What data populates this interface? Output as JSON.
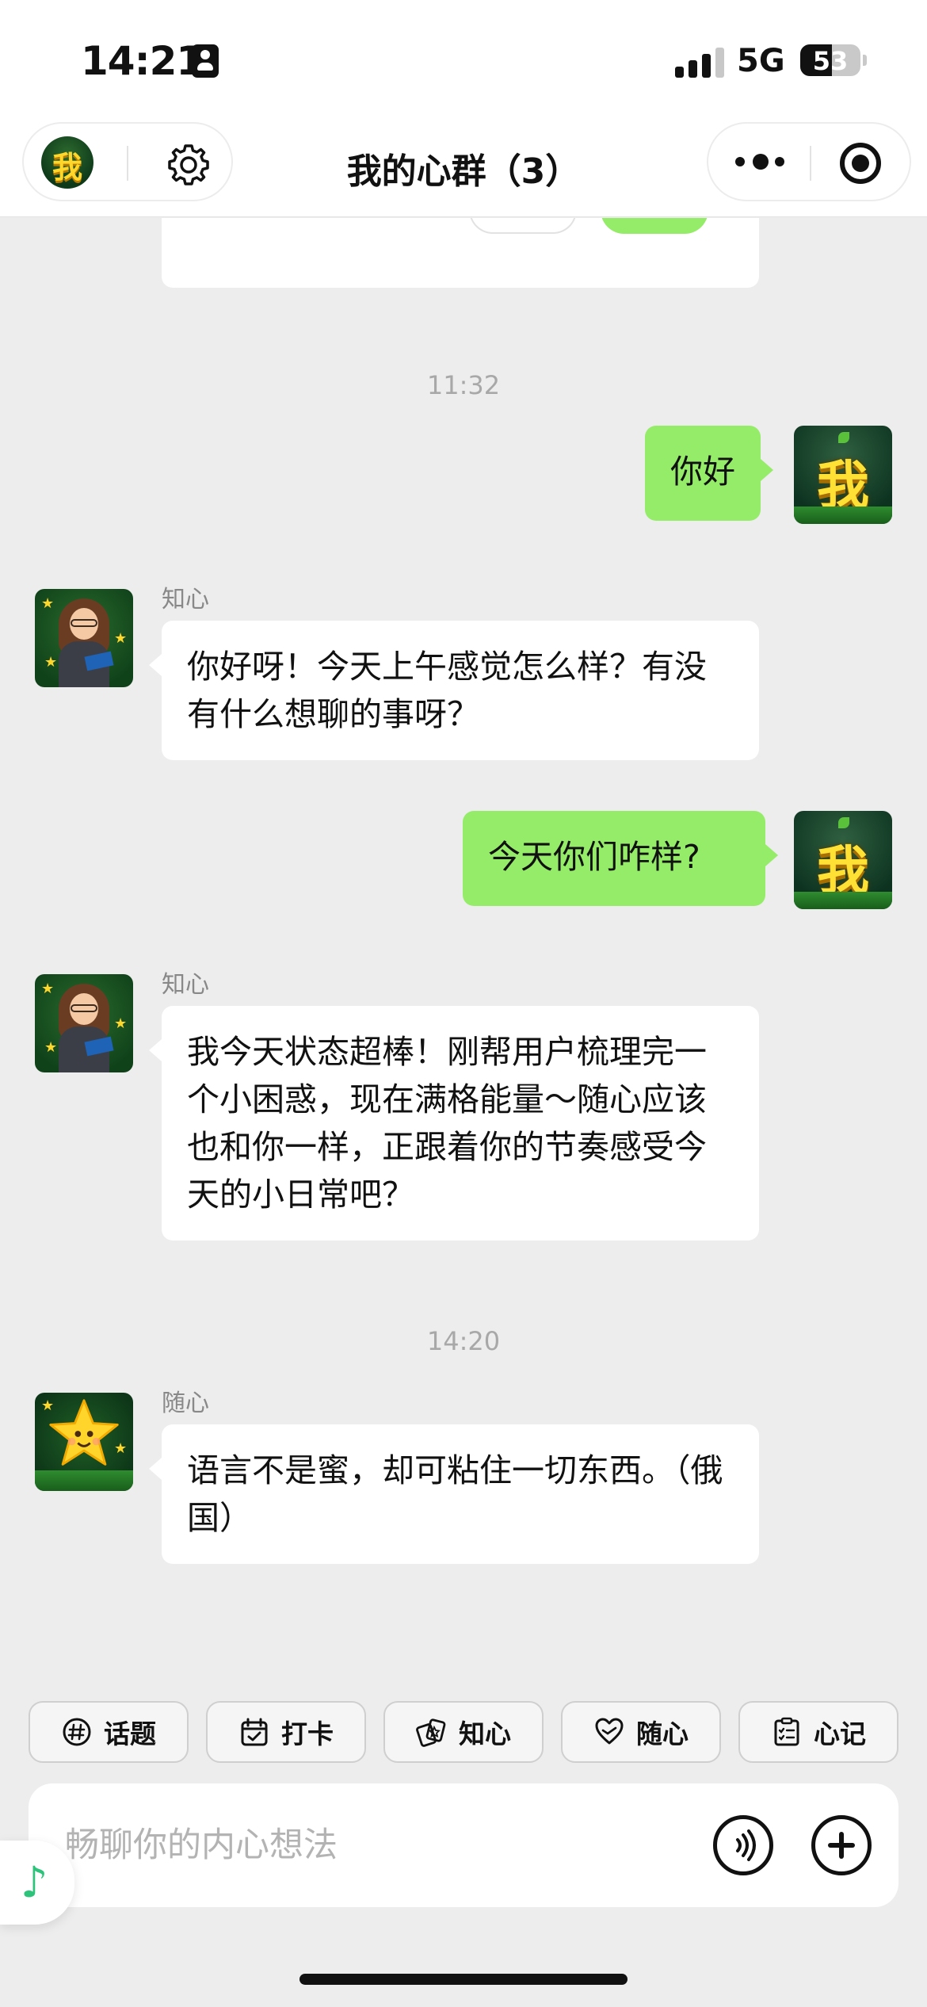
{
  "status_bar": {
    "time": "14:21",
    "network": "5G",
    "battery_level": "53",
    "battery_fraction": 0.53
  },
  "nav": {
    "title": "我的心群（3）",
    "avatar_text": "我",
    "icons": [
      "gear-icon",
      "more-icon",
      "target-icon"
    ]
  },
  "messages": {
    "ts1": "11:32",
    "m1": {
      "sender": "me",
      "text": "你好"
    },
    "m2": {
      "sender": "知心",
      "text": "你好呀！今天上午感觉怎么样？有没有什么想聊的事呀？"
    },
    "m3": {
      "sender": "me",
      "text": "今天你们咋样?"
    },
    "m4": {
      "sender": "知心",
      "text": "我今天状态超棒！刚帮用户梳理完一个小困惑，现在满格能量～随心应该也和你一样，正跟着你的节奏感受今天的小日常吧？"
    },
    "ts2": "14:20",
    "m5": {
      "sender": "随心",
      "text": "语言不是蜜，却可粘住一切东西。（俄国）"
    },
    "me_avatar_text": "我"
  },
  "chips": [
    {
      "label": "话题",
      "icon": "hashtag-icon"
    },
    {
      "label": "打卡",
      "icon": "calendar-icon"
    },
    {
      "label": "知心",
      "icon": "cards-icon"
    },
    {
      "label": "随心",
      "icon": "heart-hand-icon"
    },
    {
      "label": "心记",
      "icon": "checklist-icon"
    }
  ],
  "input": {
    "placeholder": "畅聊你的内心想法",
    "value": ""
  },
  "colors": {
    "accent_green": "#95ec69",
    "background": "#ededed",
    "music_icon": "#2dc37a"
  }
}
